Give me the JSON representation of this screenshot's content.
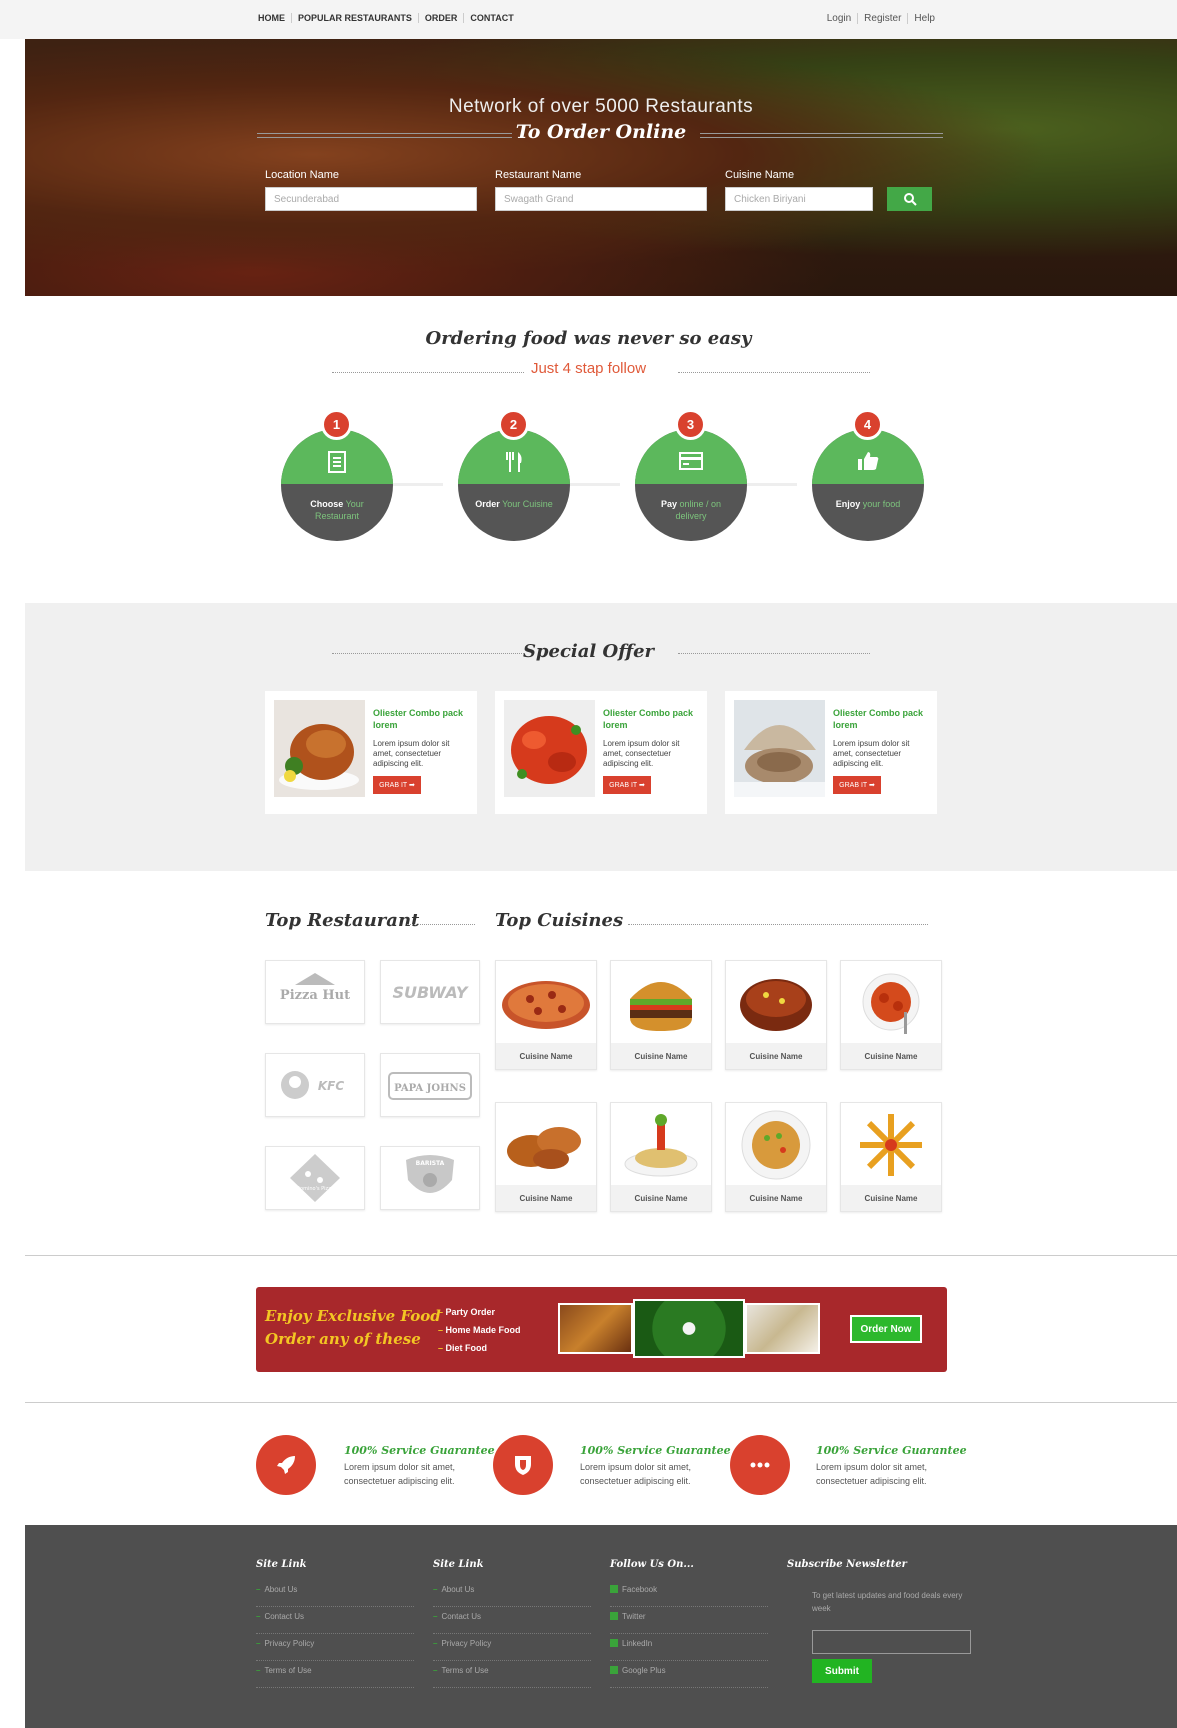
{
  "nav": {
    "left": [
      "HOME",
      "POPULAR RESTAURANTS",
      "ORDER",
      "CONTACT"
    ],
    "right": [
      "Login",
      "Register",
      "Help"
    ]
  },
  "hero": {
    "headline": "Network of over 5000 Restaurants",
    "subheadline": "To Order Online",
    "location_label": "Location Name",
    "location_placeholder": "Secunderabad",
    "restaurant_label": "Restaurant Name",
    "restaurant_placeholder": "Swagath Grand",
    "cuisine_label": "Cuisine Name",
    "cuisine_placeholder": "Chicken Biriyani",
    "search_icon": "search-icon"
  },
  "steps": {
    "title": "Ordering food was never so easy",
    "subtitle": "Just 4 stap follow",
    "items": [
      {
        "num": "1",
        "bold": "Choose",
        "rest": "Your Restaurant",
        "icon": "menu-icon"
      },
      {
        "num": "2",
        "bold": "Order",
        "rest": "Your Cuisine",
        "icon": "cutlery-icon"
      },
      {
        "num": "3",
        "bold": "Pay",
        "rest": "online / on delivery",
        "icon": "credit-card-icon"
      },
      {
        "num": "4",
        "bold": "Enjoy",
        "rest": "your food",
        "icon": "thumbs-up-icon"
      }
    ]
  },
  "offers": {
    "title": "Special Offer",
    "items": [
      {
        "title": "Oliester Combo pack lorem",
        "desc": "Lorem ipsum dolor sit amet, consectetuer adipiscing elit.",
        "button": "GRAB IT ➡"
      },
      {
        "title": "Oliester Combo pack lorem",
        "desc": "Lorem ipsum dolor sit amet, consectetuer adipiscing elit.",
        "button": "GRAB IT ➡"
      },
      {
        "title": "Oliester Combo pack lorem",
        "desc": "Lorem ipsum dolor sit amet, consectetuer adipiscing elit.",
        "button": "GRAB IT ➡"
      }
    ]
  },
  "top_restaurant": {
    "title": "Top Restaurant",
    "logos": [
      "Pizza Hut",
      "SUBWAY",
      "KFC",
      "PAPA JOHNS",
      "Domino's Pizza",
      "BARISTA"
    ]
  },
  "top_cuisines": {
    "title": "Top Cuisines",
    "items": [
      "Cuisine Name",
      "Cuisine Name",
      "Cuisine Name",
      "Cuisine Name",
      "Cuisine Name",
      "Cuisine Name",
      "Cuisine Name",
      "Cuisine Name"
    ]
  },
  "banner": {
    "line1": "Enjoy Exclusive Food",
    "line2": "Order any of these",
    "list": [
      "Party Order",
      "Home Made Food",
      "Diet Food"
    ],
    "dash": "–",
    "button": "Order Now"
  },
  "guarantees": [
    {
      "title": "100% Service Guarantee",
      "desc1": "Lorem ipsum dolor sit amet,",
      "desc2": "consectetuer adipiscing elit.",
      "icon": "rocket-icon"
    },
    {
      "title": "100% Service Guarantee",
      "desc1": "Lorem ipsum dolor sit amet,",
      "desc2": "consectetuer adipiscing elit.",
      "icon": "shield-icon"
    },
    {
      "title": "100% Service Guarantee",
      "desc1": "Lorem ipsum dolor sit amet,",
      "desc2": "consectetuer adipiscing elit.",
      "icon": "more-icon"
    }
  ],
  "footer": {
    "col1": {
      "title": "Site Link",
      "items": [
        "About Us",
        "Contact Us",
        "Privacy Policy",
        "Terms of Use"
      ]
    },
    "col2": {
      "title": "Site Link",
      "items": [
        "About Us",
        "Contact Us",
        "Privacy Policy",
        "Terms of Use"
      ]
    },
    "col3": {
      "title": "Follow Us On...",
      "items": [
        "Facebook",
        "Twitter",
        "LinkedIn",
        "Google Plus"
      ]
    },
    "col4": {
      "title": "Subscribe Newsletter",
      "desc": "To get latest updates and food deals every week",
      "button": "Submit"
    }
  },
  "colors": {
    "green": "#5cb85c",
    "red": "#d9412e",
    "banner": "#a8282b",
    "footer": "#4f4f4f"
  }
}
